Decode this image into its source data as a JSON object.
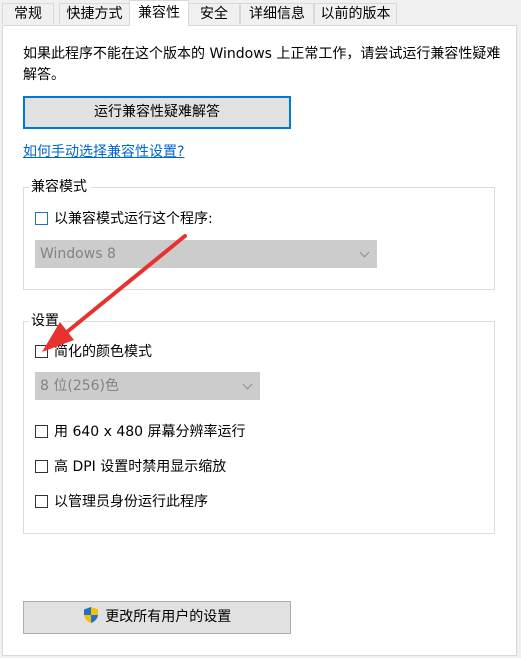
{
  "tabs": [
    {
      "label": "常规",
      "active": false
    },
    {
      "label": "快捷方式",
      "active": false
    },
    {
      "label": "兼容性",
      "active": true
    },
    {
      "label": "安全",
      "active": false
    },
    {
      "label": "详细信息",
      "active": false
    },
    {
      "label": "以前的版本",
      "active": false
    }
  ],
  "intro_text": "如果此程序不能在这个版本的 Windows 上正常工作，请尝试运行兼容性疑难解答。",
  "troubleshoot_button": "运行兼容性疑难解答",
  "manual_link": "如何手动选择兼容性设置?",
  "compat_mode": {
    "legend": "兼容模式",
    "checkbox_label": "以兼容模式运行这个程序:",
    "checked": false,
    "os_select_value": "Windows 8"
  },
  "settings": {
    "legend": "设置",
    "reduced_color": {
      "label": "简化的颜色模式",
      "checked": false
    },
    "color_select_value": "8 位(256)色",
    "res_640": {
      "label": "用 640 x 480 屏幕分辨率运行",
      "checked": false
    },
    "high_dpi": {
      "label": "高 DPI 设置时禁用显示缩放",
      "checked": false
    },
    "run_admin": {
      "label": "以管理员身份运行此程序",
      "checked": false
    }
  },
  "all_users_button": "更改所有用户的设置",
  "colors": {
    "accent": "#0078d7",
    "link": "#0066cc",
    "annotation_arrow": "#e8322f"
  },
  "icons": {
    "shield": "uac-shield-icon"
  }
}
